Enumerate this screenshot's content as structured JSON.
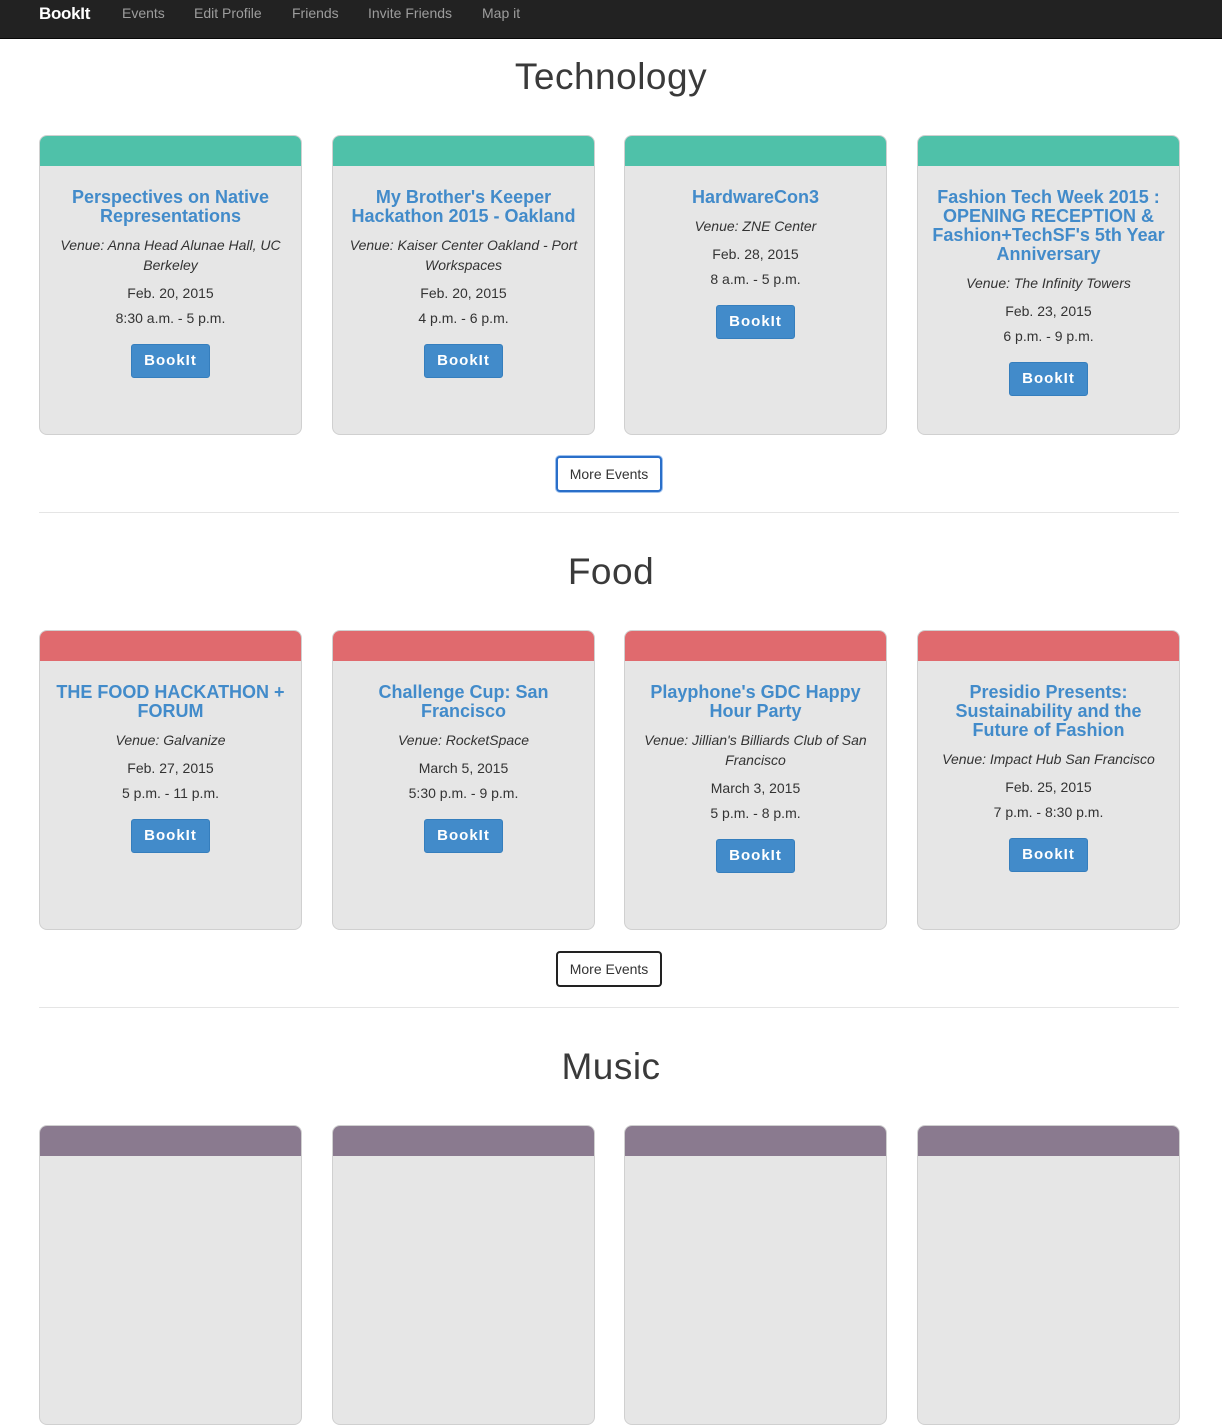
{
  "navbar": {
    "brand": "BookIt",
    "items": [
      {
        "label": "Events"
      },
      {
        "label": "Edit Profile"
      },
      {
        "label": "Friends"
      },
      {
        "label": "Invite Friends"
      },
      {
        "label": "Map it"
      }
    ]
  },
  "colors": {
    "technology": "#4fc1a9",
    "food": "#e06a6e",
    "music": "#8a7a8f",
    "link": "#428bca",
    "button": "#428bca"
  },
  "sections": [
    {
      "title": "Technology",
      "more_label": "More Events",
      "events": [
        {
          "title": "Perspectives on Native Representations",
          "venue": "Venue: Anna Head Alunae Hall, UC Berkeley",
          "date": "Feb. 20, 2015",
          "time": "8:30 a.m. - 5 p.m.",
          "button": "BookIt"
        },
        {
          "title": "My Brother's Keeper Hackathon 2015 - Oakland",
          "venue": "Venue: Kaiser Center Oakland - Port Workspaces",
          "date": "Feb. 20, 2015",
          "time": "4 p.m. - 6 p.m.",
          "button": "BookIt"
        },
        {
          "title": "HardwareCon3",
          "venue": "Venue: ZNE Center",
          "date": "Feb. 28, 2015",
          "time": "8 a.m. - 5 p.m.",
          "button": "BookIt"
        },
        {
          "title": "Fashion Tech Week 2015 : OPENING RECEPTION & Fashion+TechSF's 5th Year Anniversary",
          "venue": "Venue: The Infinity Towers",
          "date": "Feb. 23, 2015",
          "time": "6 p.m. - 9 p.m.",
          "button": "BookIt"
        }
      ]
    },
    {
      "title": "Food",
      "more_label": "More Events",
      "events": [
        {
          "title": "THE FOOD HACKATHON + FORUM",
          "venue": "Venue: Galvanize",
          "date": "Feb. 27, 2015",
          "time": "5 p.m. - 11 p.m.",
          "button": "BookIt"
        },
        {
          "title": "Challenge Cup: San Francisco",
          "venue": "Venue: RocketSpace",
          "date": "March 5, 2015",
          "time": "5:30 p.m. - 9 p.m.",
          "button": "BookIt"
        },
        {
          "title": "Playphone's GDC Happy Hour Party",
          "venue": "Venue: Jillian's Billiards Club of San Francisco",
          "date": "March 3, 2015",
          "time": "5 p.m. - 8 p.m.",
          "button": "BookIt"
        },
        {
          "title": "Presidio Presents: Sustainability and the Future of Fashion",
          "venue": "Venue: Impact Hub San Francisco",
          "date": "Feb. 25, 2015",
          "time": "7 p.m. - 8:30 p.m.",
          "button": "BookIt"
        }
      ]
    },
    {
      "title": "Music"
    }
  ]
}
